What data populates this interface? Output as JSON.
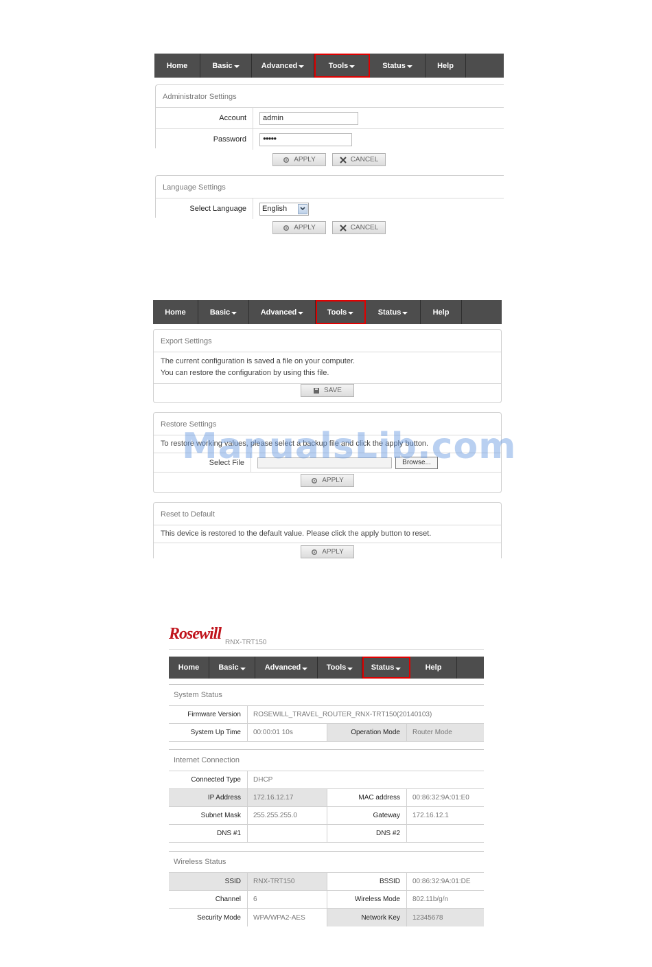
{
  "nav": {
    "items": [
      "Home",
      "Basic",
      "Advanced",
      "Tools",
      "Status",
      "Help"
    ]
  },
  "buttons": {
    "apply": "APPLY",
    "cancel": "CANCEL",
    "save": "SAVE"
  },
  "admin": {
    "title": "Administrator Settings",
    "account_label": "Account",
    "account_value": "admin",
    "password_label": "Password",
    "password_value": "●●●●●"
  },
  "language": {
    "title": "Language Settings",
    "select_label": "Select Language",
    "selected": "English"
  },
  "export": {
    "title": "Export Settings",
    "line1": "The current configuration is saved a file on your computer.",
    "line2": "You can restore the configuration by using this file."
  },
  "restore": {
    "title": "Restore Settings",
    "note": "To restore working values, please select a backup file and click the apply button.",
    "select_file_label": "Select File",
    "browse": "Browse..."
  },
  "reset": {
    "title": "Reset to Default",
    "note": "This device is restored to the default value. Please click the apply button to reset."
  },
  "watermark": "ManualsLib.com",
  "brand": {
    "logo": "Rosewill",
    "model": "RNX-TRT150"
  },
  "status": {
    "system": {
      "title": "System Status",
      "firmware_label": "Firmware Version",
      "firmware_value": "ROSEWILL_TRAVEL_ROUTER_RNX-TRT150(20140103)",
      "uptime_label": "System Up Time",
      "uptime_value": "00:00:01 10s",
      "opmode_label": "Operation Mode",
      "opmode_value": "Router Mode"
    },
    "internet": {
      "title": "Internet Connection",
      "conn_label": "Connected Type",
      "conn_value": "DHCP",
      "ip_label": "IP Address",
      "ip_value": "172.16.12.17",
      "mac_label": "MAC address",
      "mac_value": "00:86:32:9A:01:E0",
      "mask_label": "Subnet Mask",
      "mask_value": "255.255.255.0",
      "gw_label": "Gateway",
      "gw_value": "172.16.12.1",
      "dns1_label": "DNS #1",
      "dns1_value": "",
      "dns2_label": "DNS #2",
      "dns2_value": ""
    },
    "wireless": {
      "title": "Wireless Status",
      "ssid_label": "SSID",
      "ssid_value": "RNX-TRT150",
      "bssid_label": "BSSID",
      "bssid_value": "00:86:32:9A:01:DE",
      "channel_label": "Channel",
      "channel_value": "6",
      "mode_label": "Wireless Mode",
      "mode_value": "802.11b/g/n",
      "sec_label": "Security Mode",
      "sec_value": "WPA/WPA2-AES",
      "key_label": "Network Key",
      "key_value": "12345678"
    }
  }
}
